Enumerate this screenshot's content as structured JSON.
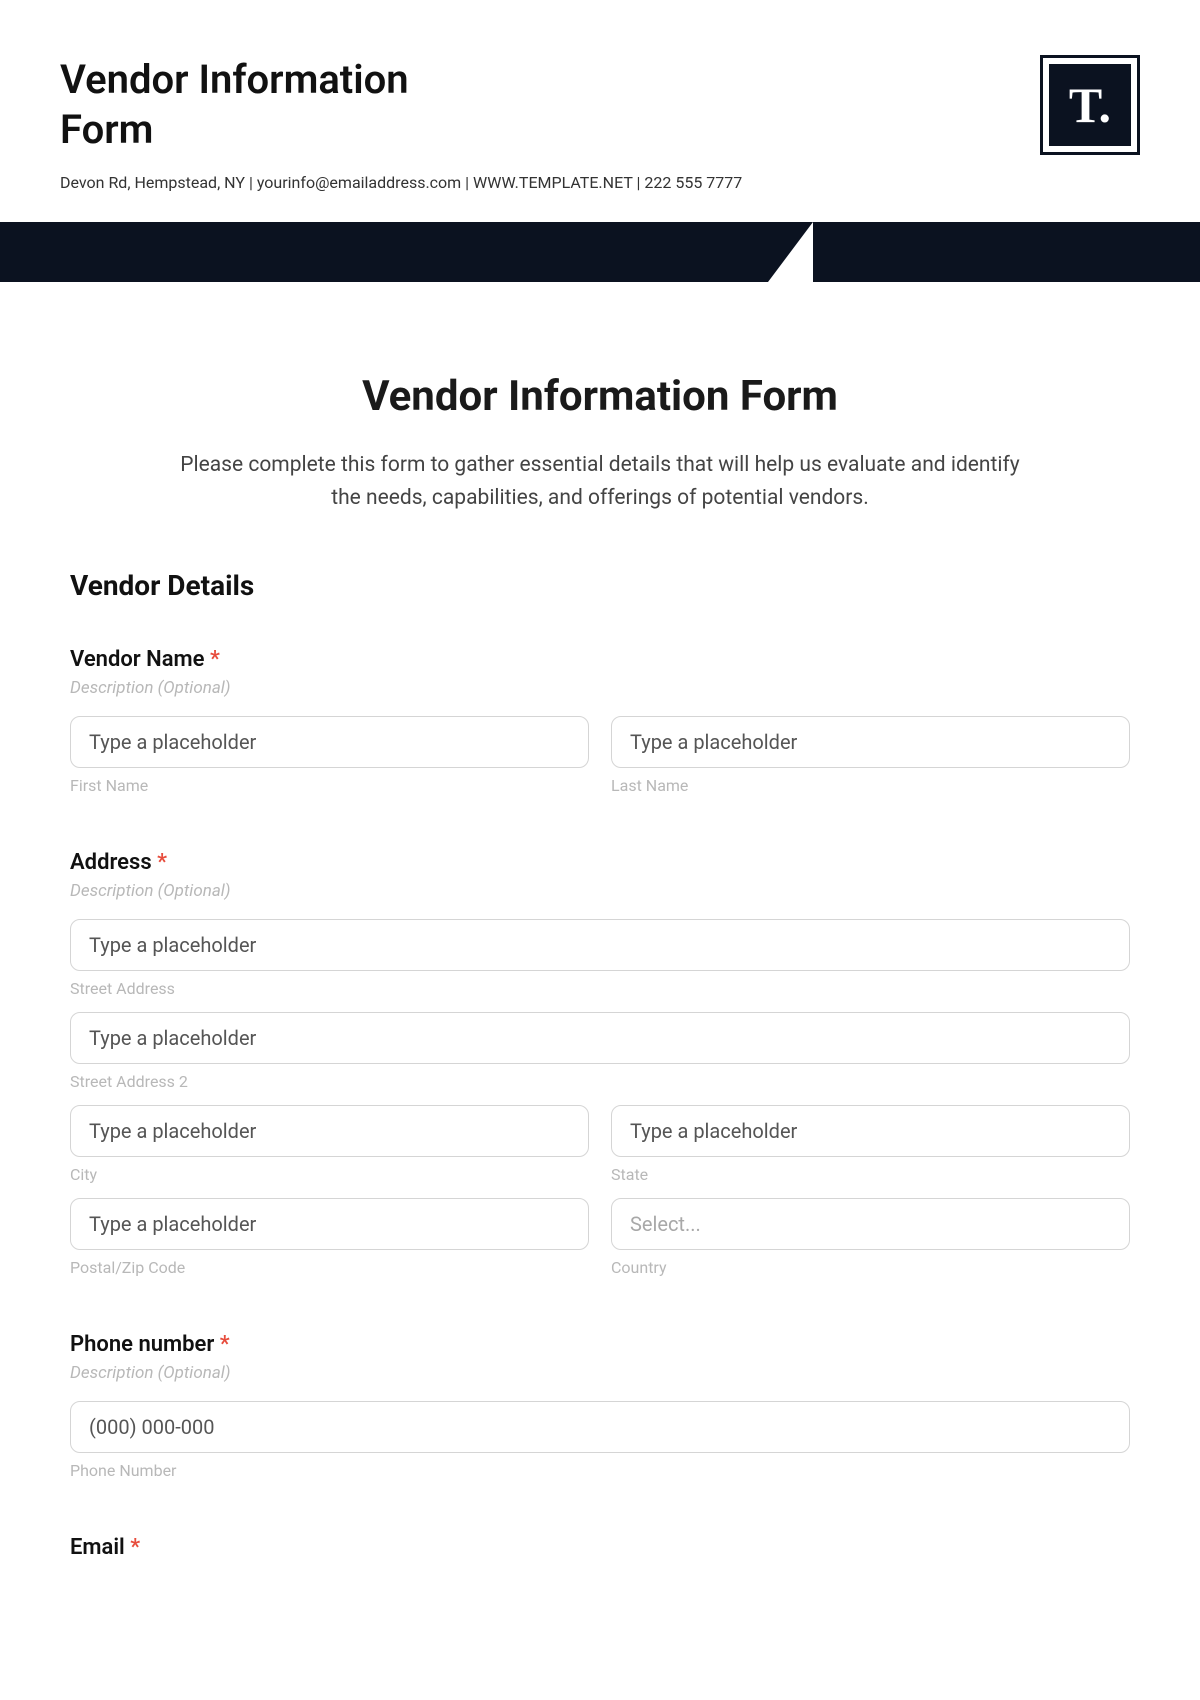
{
  "header": {
    "title": "Vendor Information Form",
    "subline": "Devon Rd, Hempstead, NY | yourinfo@emailaddress.com | WWW.TEMPLATE.NET | 222 555 7777",
    "logo_text": "T."
  },
  "form": {
    "title": "Vendor Information Form",
    "intro": "Please complete this form to gather essential details that will help us evaluate and identify the needs, capabilities, and offerings of potential vendors.",
    "section_heading": "Vendor Details",
    "vendor_name": {
      "label": "Vendor Name",
      "desc": "Description (Optional)",
      "first_ph": "Type a placeholder",
      "first_sub": "First Name",
      "last_ph": "Type a placeholder",
      "last_sub": "Last Name"
    },
    "address": {
      "label": "Address",
      "desc": "Description (Optional)",
      "street_ph": "Type a placeholder",
      "street_sub": "Street Address",
      "street2_ph": "Type a placeholder",
      "street2_sub": "Street Address 2",
      "city_ph": "Type a placeholder",
      "city_sub": "City",
      "state_ph": "Type a placeholder",
      "state_sub": "State",
      "postal_ph": "Type a placeholder",
      "postal_sub": "Postal/Zip Code",
      "country_ph": "Select...",
      "country_sub": "Country"
    },
    "phone": {
      "label": "Phone number",
      "desc": "Description (Optional)",
      "ph": "(000) 000-000",
      "sub": "Phone Number"
    },
    "email_cutoff": "Email"
  }
}
